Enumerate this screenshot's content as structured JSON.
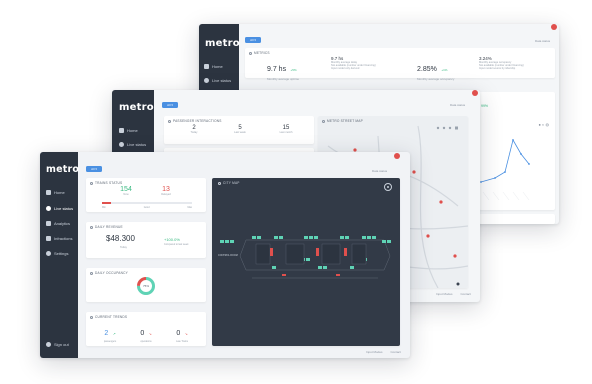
{
  "colors": {
    "sidebar": "#2c3440",
    "accent": "#4a90e2",
    "green": "#37b980",
    "red": "#e0504d",
    "map_bg": "#323a47",
    "teal": "#5fd3b5"
  },
  "back": {
    "logo": "metro",
    "filter_btn": "All ▾",
    "top_link": "Data  status",
    "nav": [
      {
        "icon": "home-icon",
        "label": "Home"
      },
      {
        "icon": "live-status-icon",
        "label": "Live status"
      }
    ],
    "card_title": "METRICS",
    "stats": [
      {
        "value": "9.7 hs",
        "delta": "+5%",
        "label": "Monthly average uptime"
      },
      {
        "value": "9.7 hs",
        "sub1": "Monthly average delay",
        "sub2": "Not available (number under financing)",
        "sub3": "Input model only derived"
      },
      {
        "value": "2.85%",
        "delta": "+1%",
        "label": "Monthly average occupancy"
      },
      {
        "value": "3.24%",
        "sub1": "Monthly average occupancy",
        "sub2": "Not available (number under financing)",
        "sub3": "Input model source by ridership"
      }
    ],
    "chart_pct": "99%"
  },
  "middle": {
    "logo": "metro",
    "filter_btn": "All ▾",
    "top_link": "Data  status",
    "nav": [
      {
        "icon": "home-icon",
        "label": "Home"
      },
      {
        "icon": "live-status-icon",
        "label": "Live status"
      }
    ],
    "passenger_title": "PASSENGER INTERACTIONS",
    "passenger_stats": [
      {
        "value": "2",
        "label": "Today"
      },
      {
        "value": "5",
        "label": "Last week"
      },
      {
        "value": "15",
        "label": "Last month"
      }
    ],
    "table_headers": [
      "#",
      "NUMBER",
      "DESTINATION",
      "STATE"
    ],
    "map_title": "METRO STREET MAP",
    "footer": [
      "Input Modes",
      "Contact"
    ]
  },
  "front": {
    "logo": "metro",
    "filter_btn": "All ▾",
    "top_link": "Data  status",
    "nav": [
      {
        "icon": "home-icon",
        "label": "Home"
      },
      {
        "icon": "live-status-icon",
        "label": "Live status"
      },
      {
        "icon": "analytics-icon",
        "label": "Analytics"
      },
      {
        "icon": "infractions-icon",
        "label": "Infractions"
      },
      {
        "icon": "settings-icon",
        "label": "Settings"
      }
    ],
    "sign_out": "Sign out",
    "trains_status": {
      "title": "TRAINS STATUS",
      "ok_value": "154",
      "ok_label": "Now",
      "delayed_value": "13",
      "delayed_label": "Delayed",
      "bar_labels": [
        "Min",
        "Good",
        "Max"
      ]
    },
    "revenue": {
      "title": "DAILY REVENUE",
      "value": "$48.300",
      "label": "Today",
      "change": "+100.0%",
      "change_label": "Compared to last week"
    },
    "occupancy": {
      "title": "DAILY OCCUPANCY",
      "center": "75%",
      "ring_fraction": 0.75
    },
    "current_trends": {
      "title": "CURRENT TRENDS",
      "items": [
        {
          "value": "2",
          "arrow": "↗",
          "label": "passengers"
        },
        {
          "value": "0",
          "arrow": "↘",
          "label": "operations"
        },
        {
          "value": "0",
          "arrow": "↘",
          "label": "Late Trains"
        }
      ]
    },
    "map": {
      "title": "CITY MAP",
      "station_label": "CONTROL ROOM"
    },
    "footer": [
      "Input Modes",
      "Contact"
    ]
  }
}
